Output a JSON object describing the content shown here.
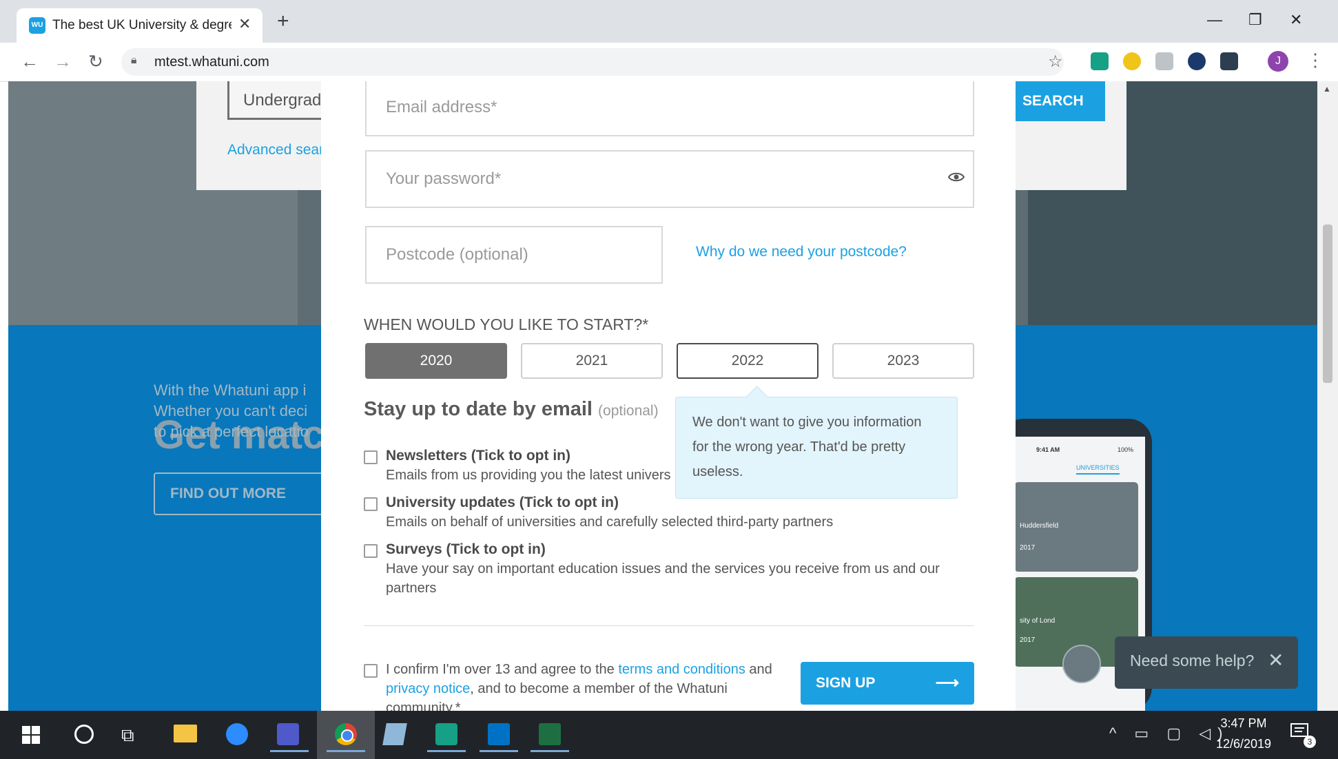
{
  "browser": {
    "tab_title": "The best UK University & degree",
    "tab_favicon": "WU",
    "url": "mtest.whatuni.com",
    "profile_initial": "J"
  },
  "background_page": {
    "course_select_value": "Undergrad",
    "advanced_search_label": "Advanced sear",
    "search_button_label": "SEARCH",
    "getmatch_title": "Get matc",
    "app_text_lines": [
      "With the Whatuni app i",
      "Whether you can't deci",
      "to pick a perfect locatio"
    ],
    "find_out_button_label": "FIND OUT MORE",
    "phone": {
      "time": "9:41 AM",
      "battery": "100%",
      "tab_label": "UNIVERSITIES",
      "cards": [
        {
          "label": "Huddersfield",
          "year": "2017"
        },
        {
          "label": "sity of Lond",
          "year": "2017"
        }
      ]
    },
    "help_widget_text": "Need some help?"
  },
  "modal": {
    "email_placeholder": "Email address*",
    "password_placeholder": "Your password*",
    "postcode_placeholder": "Postcode (optional)",
    "why_postcode_link": "Why do we need your postcode?",
    "start_label": "WHEN WOULD YOU LIKE TO START?*",
    "years": [
      "2020",
      "2021",
      "2022",
      "2023"
    ],
    "selected_year": "2020",
    "hovered_year": "2022",
    "tooltip_text": "We don't want to give you information for the wrong year. That'd be pretty useless.",
    "stay_heading": "Stay up to date by email",
    "stay_optional": "(optional)",
    "options": [
      {
        "title": "Newsletters (Tick to opt in)",
        "desc": "Emails from us providing you the latest univers",
        "checked": false
      },
      {
        "title": "University updates (Tick to opt in)",
        "desc": "Emails on behalf of universities and carefully selected third-party partners",
        "checked": false
      },
      {
        "title": "Surveys (Tick to opt in)",
        "desc": "Have your say on important education issues and the services you receive from us and our partners",
        "checked": false
      }
    ],
    "confirm": {
      "part1": "I confirm I'm over 13 and agree to the ",
      "terms_link": "terms and conditions",
      "part2": " and ",
      "privacy_link": "privacy notice",
      "part3": ", and to become a member of the Whatuni community.*",
      "checked": false
    },
    "signup_label": "SIGN UP",
    "signup_arrow": "⟶"
  },
  "taskbar": {
    "time": "3:47 PM",
    "date": "12/6/2019",
    "notification_count": "3"
  },
  "colors": {
    "accent": "#1ba1e2",
    "blue_section": "#0877bc",
    "selected_year_bg": "#707070",
    "tooltip_bg": "#e2f4fc",
    "taskbar_bg": "#202428"
  }
}
